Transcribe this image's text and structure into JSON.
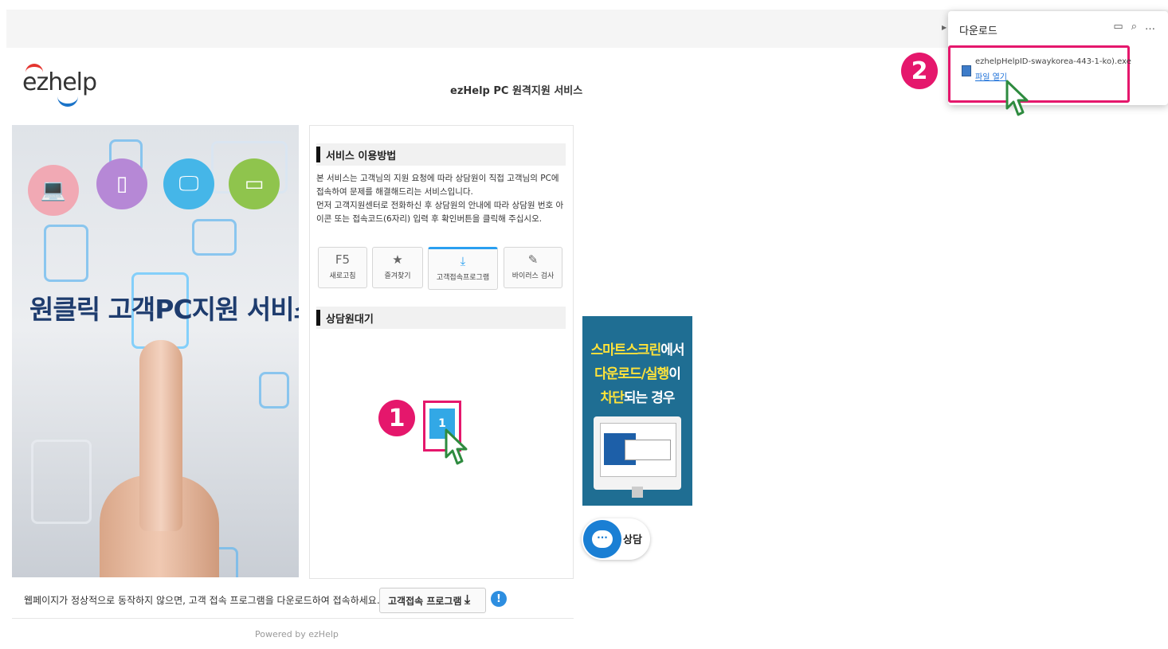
{
  "logo": {
    "text": "ezhelp"
  },
  "header": {
    "site_title": "ezHelp PC 원격지원 서비스"
  },
  "hero": {
    "title": "원클릭 고객PC지원 서비스"
  },
  "usage": {
    "heading": "서비스 이용방법",
    "description_1": "본 서비스는 고객님의 지원 요청에 따라 상담원이 직접 고객님의 PC에 접속하여 문제를 해결해드리는 서비스입니다.",
    "description_2": "먼저 고객지원센터로 전화하신 후 상담원의 안내에 따라 상담원 번호 아이콘 또는 접속코드(6자리) 입력 후 확인버튼을 클릭해 주십시오."
  },
  "tools": [
    {
      "icon": "F5",
      "label": "새로고침"
    },
    {
      "icon": "★",
      "label": "즐겨찾기"
    },
    {
      "icon": "⤓",
      "label": "고객접속프로그램"
    },
    {
      "icon": "✎",
      "label": "바이러스 검사"
    }
  ],
  "waiting": {
    "heading": "상담원대기",
    "agent_number": "1"
  },
  "steps": {
    "step1": "1",
    "step2": "2"
  },
  "banner": {
    "line1_highlight": "스마트스크린",
    "line1_rest": "에서",
    "line2_highlight": "다운로드/실행",
    "line2_rest": "이",
    "line3_highlight": "차단",
    "line3_rest": "되는 경우"
  },
  "chat": {
    "label": "상담"
  },
  "footer": {
    "note": "웹페이지가 정상적으로 동작하지 않으면, 고객 접속 프로그램을 다운로드하여 접속하세요.",
    "download_button": "고객접속 프로그램",
    "powered": "Powered by ezHelp"
  },
  "download_panel": {
    "title": "다운로드",
    "file_name": "ezhelpHelpID-swaykorea-443-1-ko).exe",
    "open_link": "파일 열기"
  },
  "colors": {
    "accent": "#e5176c",
    "blue": "#2a9ff0",
    "banner_bg": "#1f6e93",
    "highlight": "#ffe33a"
  }
}
